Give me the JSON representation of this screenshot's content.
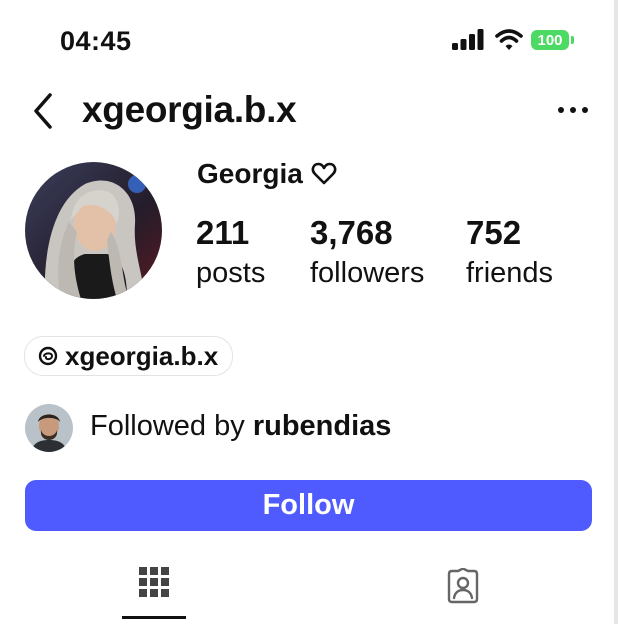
{
  "status_bar": {
    "time": "04:45",
    "battery": "100",
    "battery_color": "#4cd964"
  },
  "header": {
    "username": "xgeorgia.b.x",
    "back_icon": "chevron-left-icon",
    "more_icon": "ellipsis-horizontal-icon"
  },
  "profile": {
    "display_name": "Georgia",
    "name_icon": "heart-outline-icon",
    "stats": [
      {
        "value": "211",
        "label": "posts"
      },
      {
        "value": "3,768",
        "label": "followers"
      },
      {
        "value": "752",
        "label": "friends"
      }
    ]
  },
  "threads": {
    "handle": "xgeorgia.b.x",
    "icon": "threads-icon"
  },
  "followed_by": {
    "prefix": "Followed by",
    "user": "rubendias"
  },
  "actions": {
    "follow_label": "Follow",
    "follow_color": "#4f5bff"
  },
  "tabs": [
    {
      "icon": "grid-icon",
      "active": true
    },
    {
      "icon": "tagged-person-icon",
      "active": false
    }
  ]
}
